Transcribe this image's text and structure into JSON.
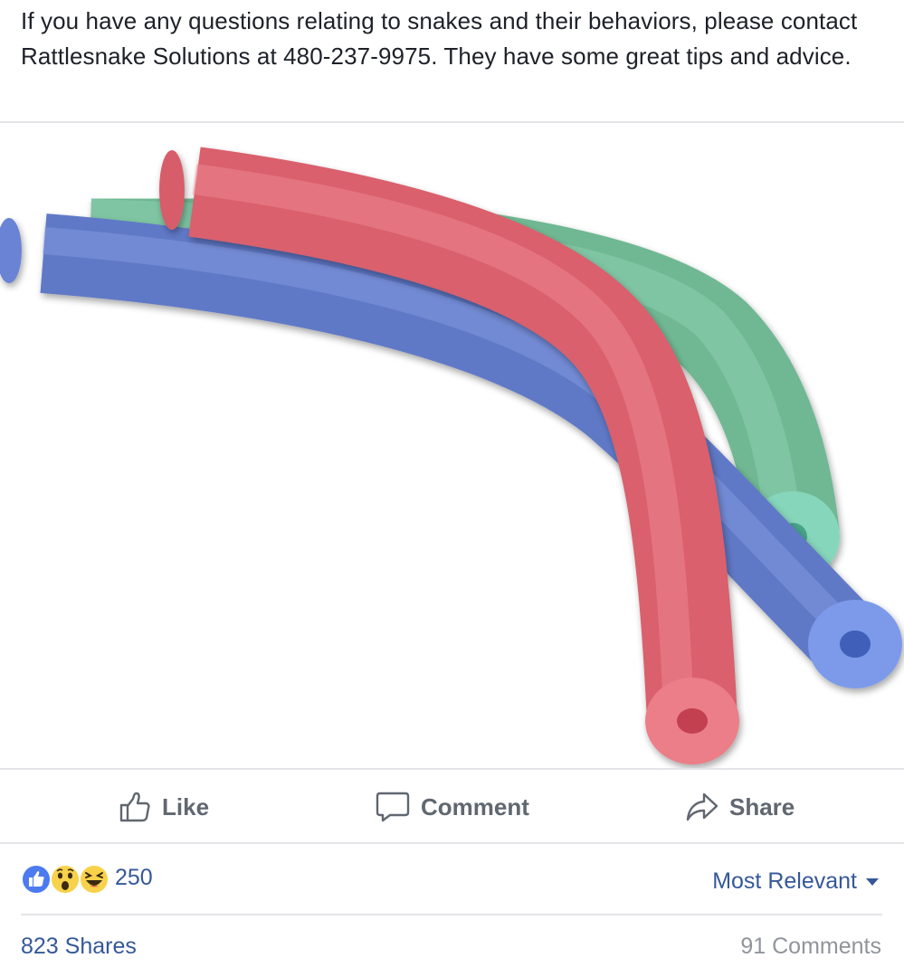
{
  "post": {
    "text": "If you have any questions relating to snakes and their behaviors, please contact Rattlesnake Solutions at 480-237-9975. They have some great tips and advice."
  },
  "photo": {
    "subject": "pool noodles",
    "noodle_colors": {
      "red": "#e06a74",
      "green": "#7fc7a6",
      "blue": "#6f86d6"
    }
  },
  "actions": {
    "like_label": "Like",
    "comment_label": "Comment",
    "share_label": "Share",
    "like_icon": "thumbs-up-icon",
    "comment_icon": "speech-bubble-icon",
    "share_icon": "share-arrow-icon"
  },
  "reactions": {
    "icons": [
      "like-reaction-icon",
      "wow-reaction-icon",
      "haha-reaction-icon"
    ],
    "count": "250"
  },
  "sort": {
    "label": "Most Relevant"
  },
  "stats": {
    "shares": "823 Shares",
    "comments": "91 Comments"
  },
  "colors": {
    "link": "#365899",
    "muted": "#90949c",
    "action": "#606770",
    "like_blue": "#4c7bf0",
    "emoji_yellow": "#f7d24a"
  }
}
